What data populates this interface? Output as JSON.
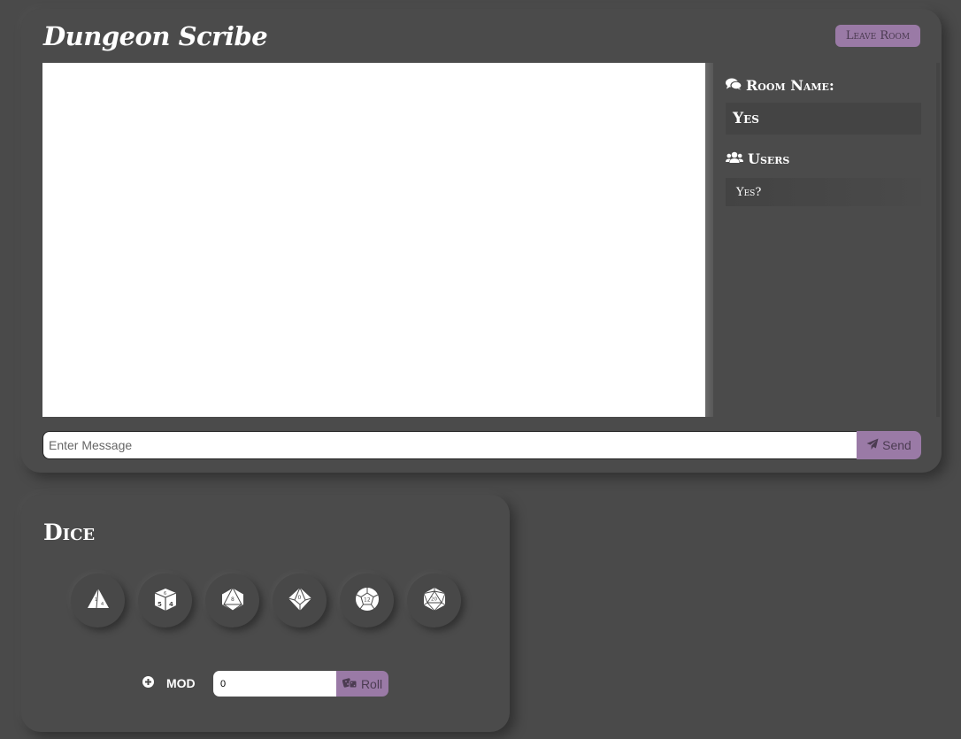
{
  "header": {
    "app_title": "Dungeon Scribe",
    "leave_button": "Leave Room"
  },
  "sidebar": {
    "room_heading": "Room Name:",
    "room_name": "Yes",
    "users_heading": "Users",
    "users": [
      "Yes?"
    ]
  },
  "composer": {
    "placeholder": "Enter Message",
    "send_label": "Send"
  },
  "dice": {
    "title": "Dice",
    "dice_types": [
      {
        "name": "d4",
        "icon": "d4-icon"
      },
      {
        "name": "d6",
        "icon": "d6-icon"
      },
      {
        "name": "d8",
        "icon": "d8-icon"
      },
      {
        "name": "d10",
        "icon": "d10-icon"
      },
      {
        "name": "d12",
        "icon": "d12-icon"
      },
      {
        "name": "d20",
        "icon": "d20-icon"
      }
    ],
    "mod_label": "MOD",
    "mod_value": "0",
    "roll_label": "Roll"
  },
  "colors": {
    "background": "#4a4a4a",
    "card": "#4b4b4b",
    "accent": "#9a7aa6",
    "accent_text": "#4c3c52"
  }
}
